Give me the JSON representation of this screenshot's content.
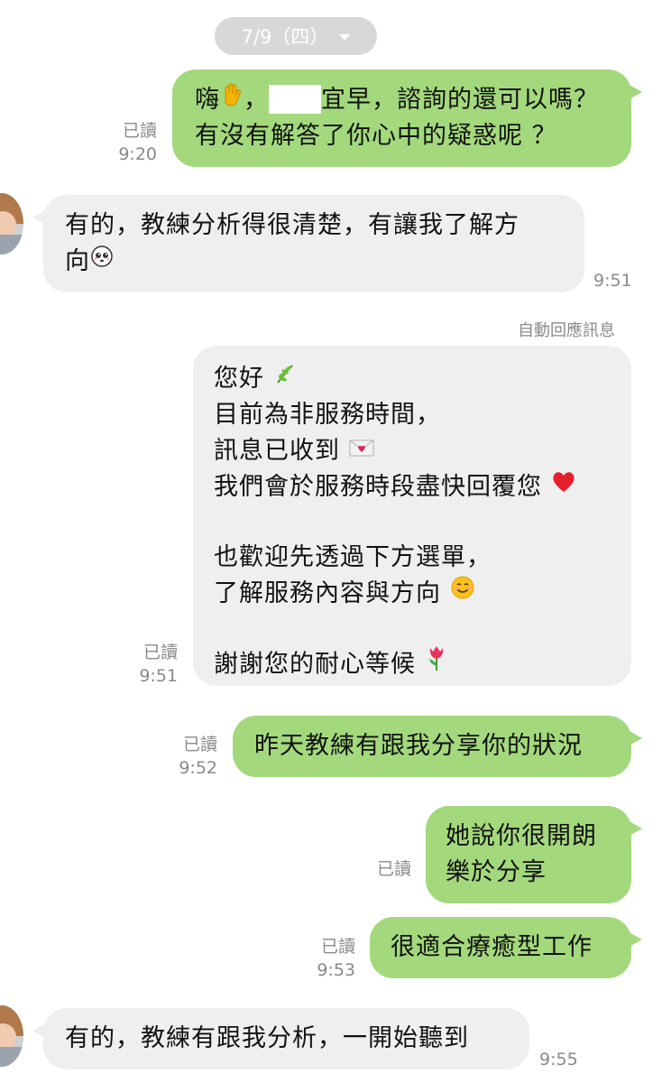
{
  "date_separator": {
    "label": "7/9（四）"
  },
  "messages": [
    {
      "lines": [
        "嗨",
        "，",
        "宜早，諮詢的還可以嗎？",
        "有沒有解答了你心中的疑惑呢 ？"
      ],
      "read": "已讀",
      "time": "9:20",
      "emoji": "waving-hand-icon"
    },
    {
      "lines": [
        "有的，教練分析得很清楚，有讓我了解方",
        "向"
      ],
      "time": "9:51",
      "emoji": "pleading-face-icon"
    },
    {
      "auto_label": "自動回應訊息",
      "lines": [
        "您好",
        "目前為非服務時間，",
        "訊息已收到",
        "我們會於服務時段盡快回覆您",
        "也歡迎先透過下方選單，",
        "了解服務內容與方向",
        "謝謝您的耐心等候"
      ],
      "read": "已讀",
      "time": "9:51",
      "emojis": [
        "herb-icon",
        "love-letter-icon",
        "red-heart-icon",
        "smiling-face-icon",
        "tulip-icon"
      ]
    },
    {
      "lines": [
        "昨天教練有跟我分享你的狀況"
      ],
      "read": "已讀",
      "time": "9:52"
    },
    {
      "lines": [
        "她說你很開朗",
        "樂於分享"
      ],
      "read": "已讀"
    },
    {
      "lines": [
        "很適合療癒型工作"
      ],
      "read": "已讀",
      "time": "9:53"
    },
    {
      "lines": [
        "有的，教練有跟我分析，一開始聽到"
      ],
      "time": "9:55"
    }
  ]
}
